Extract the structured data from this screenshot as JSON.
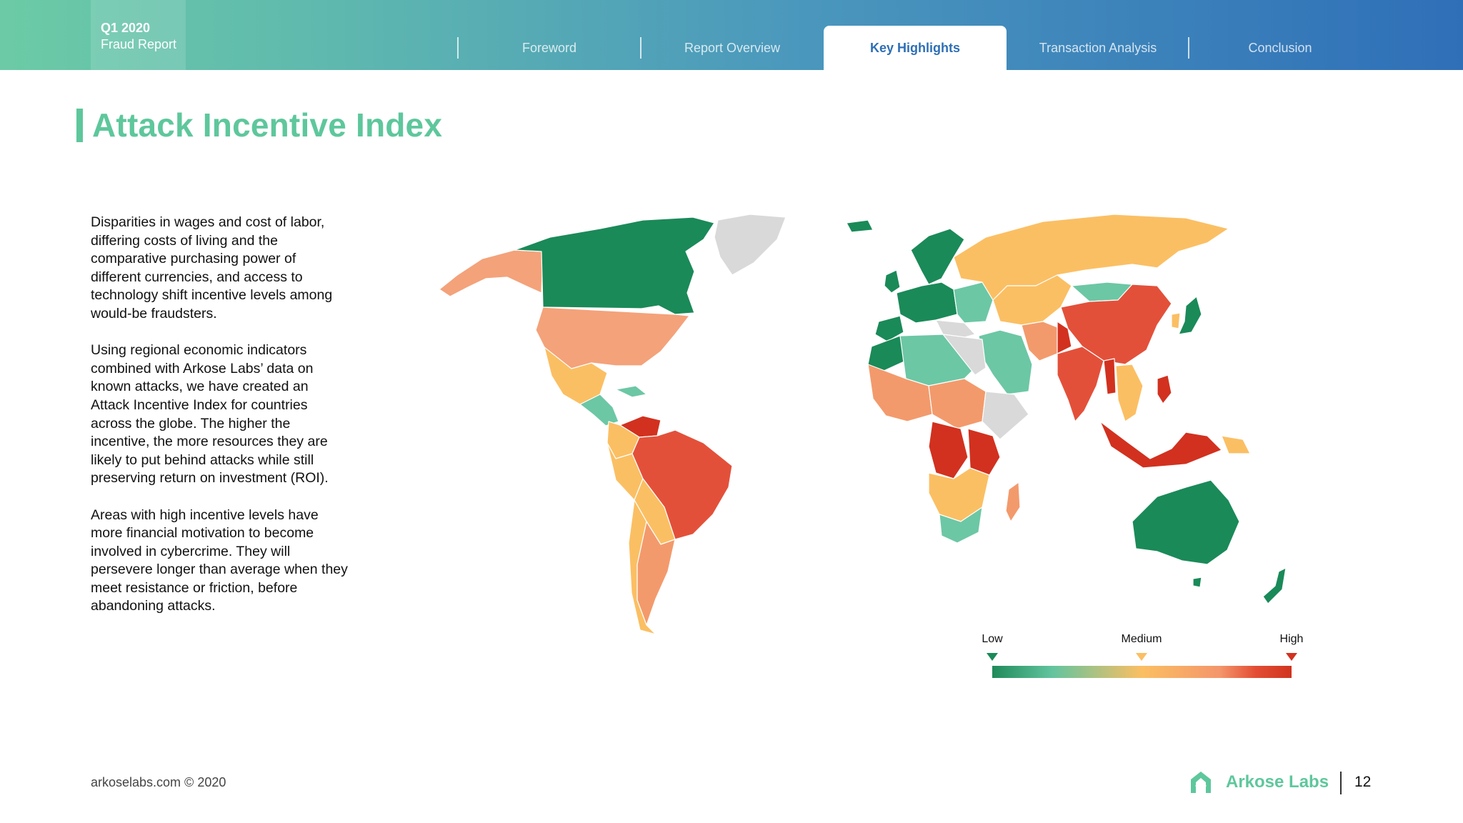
{
  "header": {
    "brand_period": "Q1 2020",
    "brand_title": "Fraud Report",
    "tabs": [
      {
        "label": "Foreword"
      },
      {
        "label": "Report Overview"
      },
      {
        "label": "Key Highlights",
        "active": true
      },
      {
        "label": "Transaction Analysis"
      },
      {
        "label": "Conclusion"
      }
    ]
  },
  "title": "Attack Incentive Index",
  "body_paragraphs": [
    "Disparities in wages and cost of labor, differing costs of living and the comparative purchasing power of different currencies, and access to technology shift incentive levels among would-be fraudsters.",
    "Using regional economic indicators combined with Arkose Labs’ data on known attacks, we have created an Attack Incentive Index for countries across the globe. The higher the incentive, the more resources they are likely to put behind attacks while still preserving return on investment (ROI).",
    "Areas with high incentive levels have more financial motivation to become involved in cybercrime. They will persevere longer than average when they meet resistance or friction, before abandoning attacks."
  ],
  "map": {
    "legend": {
      "low": "Low",
      "medium": "Medium",
      "high": "High"
    },
    "colors": {
      "low": "#1a8a58",
      "low_mid": "#6cc7a5",
      "medium": "#fbbf63",
      "medium_high": "#f39a6c",
      "high": "#e3503a",
      "very_high": "#d2311f",
      "no_data": "#d9d9d9"
    }
  },
  "footer": {
    "copyright": "arkoselabs.com © 2020",
    "logo_text": "Arkose Labs",
    "page_number": "12"
  }
}
